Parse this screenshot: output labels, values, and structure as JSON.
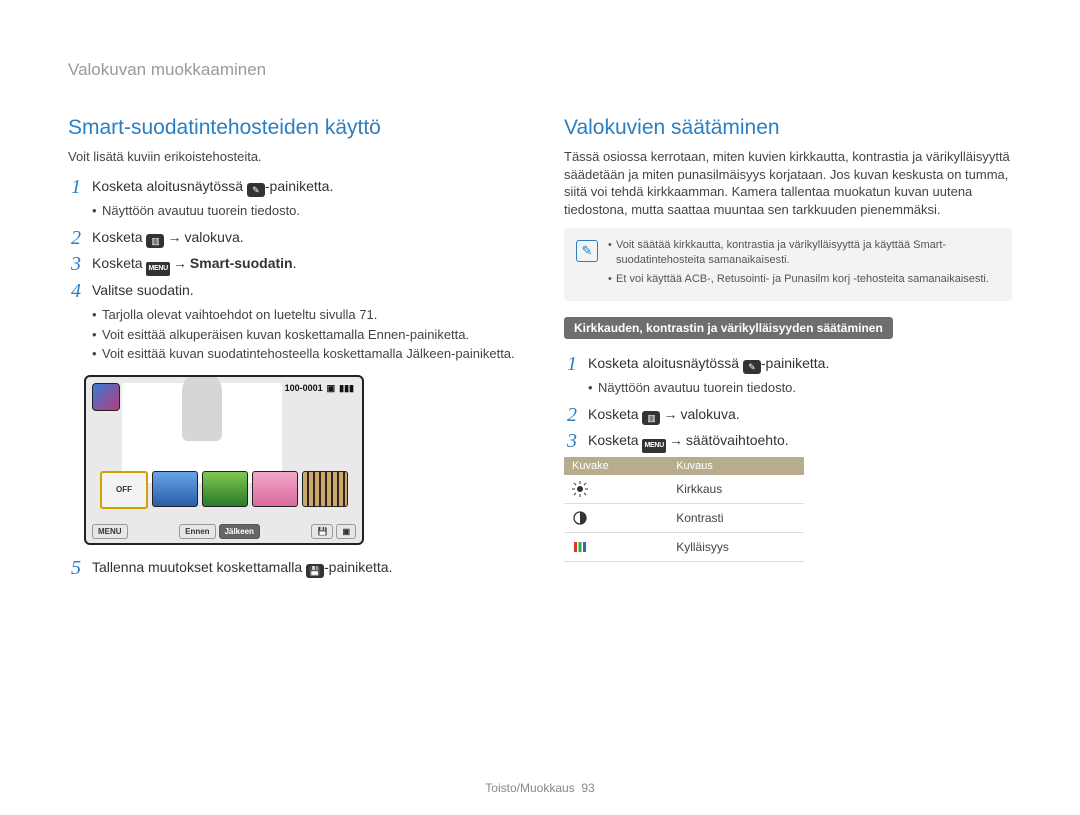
{
  "breadcrumb": "Valokuvan muokkaaminen",
  "left": {
    "heading": "Smart-suodatintehosteiden käyttö",
    "intro": "Voit lisätä kuviin erikoistehosteita.",
    "step1": {
      "text_a": "Kosketa aloitusnäytössä ",
      "text_b": "-painiketta."
    },
    "step1_sub": "Näyttöön avautuu tuorein tiedosto.",
    "step2": {
      "text_a": "Kosketa ",
      "text_b": "valokuva."
    },
    "step3": {
      "text_a": "Kosketa ",
      "text_b": "Smart-suodatin",
      "text_after": "."
    },
    "step4": "Valitse suodatin.",
    "step4_subs": [
      "Tarjolla olevat vaihtoehdot on lueteltu sivulla 71.",
      "Voit esittää alkuperäisen kuvan koskettamalla Ennen-painiketta.",
      "Voit esittää kuvan suodatintehosteella koskettamalla Jälkeen-painiketta."
    ],
    "step5": {
      "text_a": "Tallenna muutokset koskettamalla ",
      "text_b": "-painiketta."
    }
  },
  "screenshot": {
    "counter": "100-0001",
    "off": "OFF",
    "menu": "MENU",
    "before": "Ennen",
    "after": "Jälkeen"
  },
  "right": {
    "heading": "Valokuvien säätäminen",
    "intro": "Tässä osiossa kerrotaan, miten kuvien kirkkautta, kontrastia ja värikylläisyyttä säädetään ja miten punasilmäisyys korjataan. Jos kuvan keskusta on tumma, siitä voi tehdä kirkkaamman. Kamera tallentaa muokatun kuvan uutena tiedostona, mutta saattaa muuntaa sen tarkkuuden pienemmäksi.",
    "info": [
      "Voit säätää kirkkautta, kontrastia ja värikylläisyyttä ja käyttää Smart-suodatintehosteita samanaikaisesti.",
      "Et voi käyttää ACB-, Retusointi- ja Punasilm korj -tehosteita samanaikaisesti."
    ],
    "subheading": "Kirkkauden, kontrastin ja värikylläisyyden säätäminen",
    "step1": {
      "text_a": "Kosketa aloitusnäytössä ",
      "text_b": "-painiketta."
    },
    "step1_sub": "Näyttöön avautuu tuorein tiedosto.",
    "step2": {
      "text_a": "Kosketa ",
      "text_b": "valokuva."
    },
    "step3": {
      "text_a": "Kosketa ",
      "text_b": "säätövaihtoehto."
    },
    "table": {
      "headers": [
        "Kuvake",
        "Kuvaus"
      ],
      "rows": [
        {
          "icon": "brightness",
          "label": "Kirkkaus"
        },
        {
          "icon": "contrast",
          "label": "Kontrasti"
        },
        {
          "icon": "saturation",
          "label": "Kylläisyys"
        }
      ]
    }
  },
  "footer": {
    "section": "Toisto/Muokkaus",
    "page": "93"
  }
}
